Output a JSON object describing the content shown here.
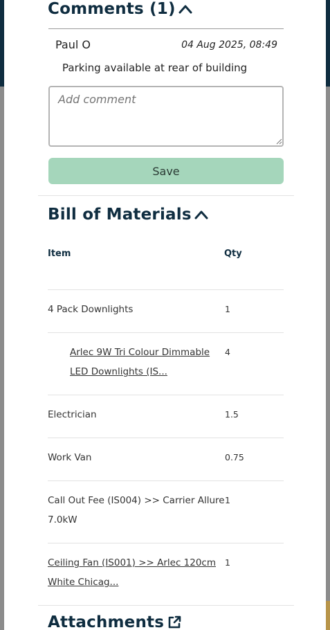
{
  "comments": {
    "title": "Comments (1)",
    "items": [
      {
        "author": "Paul O",
        "date": "04 Aug 2025, 08:49",
        "text": "Parking available at rear of building"
      }
    ],
    "input_placeholder": "Add comment",
    "save_label": "Save"
  },
  "bom": {
    "title": "Bill of Materials",
    "columns": {
      "item": "Item",
      "qty": "Qty"
    },
    "rows": [
      {
        "item_line1": "4 Pack Downlights",
        "item_line2": "",
        "qty": "1"
      },
      {
        "item_line1": "Arlec 9W Tri Colour Dimmable",
        "item_line2": "LED Downlights (IS...",
        "qty": "4"
      },
      {
        "item_line1": "Electrician",
        "item_line2": "",
        "qty": "1.5"
      },
      {
        "item_line1": "Work Van",
        "item_line2": "",
        "qty": "0.75"
      },
      {
        "item_line1": "Call Out Fee (IS004) >> Carrier Allure",
        "item_line2": "7.0kW",
        "qty": "1"
      },
      {
        "item_line1": "Ceiling Fan (IS001) >> Arlec 120cm",
        "item_line2": "White Chicag...",
        "qty": "1"
      }
    ]
  },
  "attachments": {
    "title": "Attachments"
  },
  "colors": {
    "primary": "#0f2d40",
    "save_button": "#a5d6bb",
    "backdrop": "#8c8c8c"
  }
}
